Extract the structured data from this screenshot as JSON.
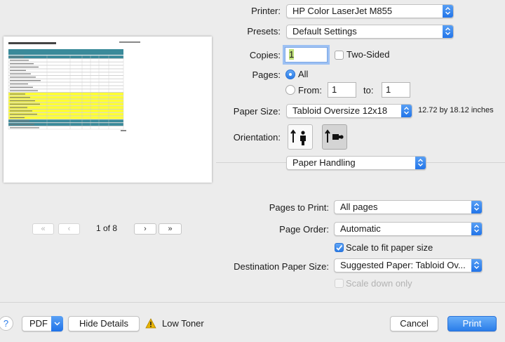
{
  "printer": {
    "label": "Printer:",
    "value": "HP Color LaserJet M855"
  },
  "presets": {
    "label": "Presets:",
    "value": "Default Settings"
  },
  "copies": {
    "label": "Copies:",
    "value": "1",
    "two_sided_label": "Two-Sided",
    "two_sided_checked": false
  },
  "pages": {
    "label": "Pages:",
    "all_label": "All",
    "from_label": "From:",
    "from_value": "1",
    "to_label": "to:",
    "to_value": "1",
    "selected": "All"
  },
  "paper_size": {
    "label": "Paper Size:",
    "value": "Tabloid Oversize 12x18",
    "dimensions": "12.72 by 18.12 inches"
  },
  "orientation": {
    "label": "Orientation:",
    "options": [
      "portrait",
      "landscape"
    ],
    "selected": "landscape"
  },
  "section": {
    "value": "Paper Handling"
  },
  "pages_to_print": {
    "label": "Pages to Print:",
    "value": "All pages"
  },
  "page_order": {
    "label": "Page Order:",
    "value": "Automatic"
  },
  "scale_to_fit": {
    "label": "Scale to fit paper size",
    "checked": true
  },
  "destination_paper": {
    "label": "Destination Paper Size:",
    "value": "Suggested Paper: Tabloid Ov..."
  },
  "scale_down": {
    "label": "Scale down only",
    "checked": false,
    "disabled": true
  },
  "preview_nav": {
    "first": "«",
    "prev": "‹",
    "page_indicator": "1 of 8",
    "next": "›",
    "last": "»"
  },
  "footer": {
    "help": "?",
    "pdf_label": "PDF",
    "hide_details": "Hide Details",
    "warning": "Low Toner",
    "cancel": "Cancel",
    "print": "Print"
  },
  "colors": {
    "accent": "#2a7de9",
    "highlight": "#ffff33",
    "warning": "#e8b400"
  },
  "icons": {
    "popup": "chevron-up-down-icon",
    "warning": "warning-triangle-icon",
    "pdf_menu": "chevron-down-icon"
  }
}
